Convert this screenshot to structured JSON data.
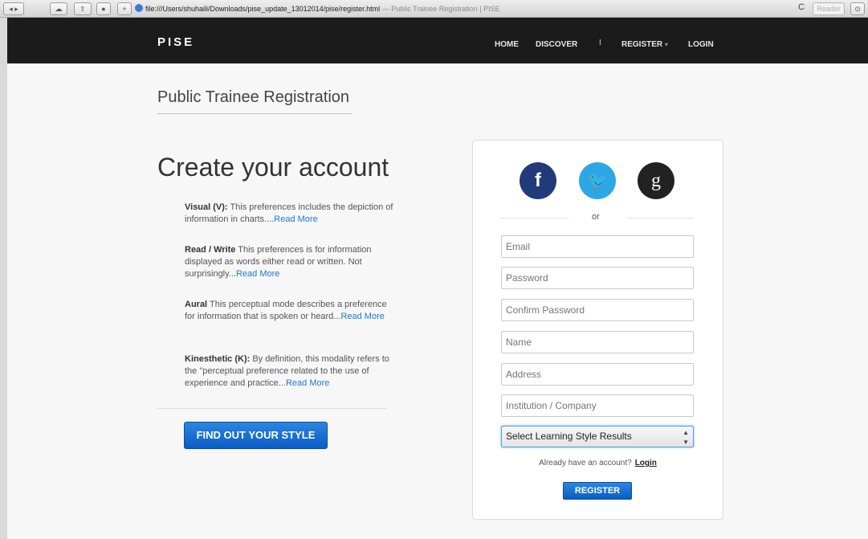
{
  "browser": {
    "url": "file:///Users/shuhaili/Downloads/pise_update_13012014/pise/register.html",
    "title_suffix": "— Public Trainee Registration | PISE",
    "reader_label": "Reader",
    "reload_glyph": "C"
  },
  "navbar": {
    "brand": "PISE",
    "items": [
      {
        "label": "HOME"
      },
      {
        "label": "DISCOVER"
      },
      {
        "label": "REGISTER"
      },
      {
        "label": "LOGIN"
      }
    ],
    "divider": "I",
    "caret": "▾"
  },
  "page": {
    "title": "Public Trainee Registration",
    "headline": "Create your account",
    "preferences": [
      {
        "title": "Visual (V):",
        "text": " This preferences includes the depiction of information in charts....",
        "link": "Read More"
      },
      {
        "title": "Read / Write",
        "text": " This preferences is for information displayed as words either read or written. Not surprisingly...",
        "link": "Read More"
      },
      {
        "title": "Aural",
        "text": " This perceptual mode describes a preference for information that is spoken or heard...",
        "link": "Read More"
      },
      {
        "title": "Kinesthetic (K):",
        "text": " By definition, this modality refers to the \"perceptual preference related to the use of experience and practice...",
        "link": "Read More"
      }
    ],
    "cta_label": "FIND OUT YOUR STYLE"
  },
  "form": {
    "social": [
      {
        "icon": "facebook-icon",
        "glyph": "f",
        "color": "#233a7a"
      },
      {
        "icon": "twitter-icon",
        "glyph": "🐦",
        "color": "#2ca7e3"
      },
      {
        "icon": "google-icon",
        "glyph": "g",
        "color": "#222222"
      }
    ],
    "or": "or",
    "placeholders": {
      "email": "Email",
      "password": "Password",
      "confirm_password": "Confirm Password",
      "name": "Name",
      "address": "Address",
      "institution": "Institution / Company"
    },
    "select_value": "Select Learning Style Results",
    "already_text": "Already have an account?",
    "login_link": "Login",
    "register_label": "REGISTER"
  },
  "colors": {
    "navbar": "#1b1b1b",
    "accent": "#0a5cc4",
    "link": "#1c7ad6"
  }
}
